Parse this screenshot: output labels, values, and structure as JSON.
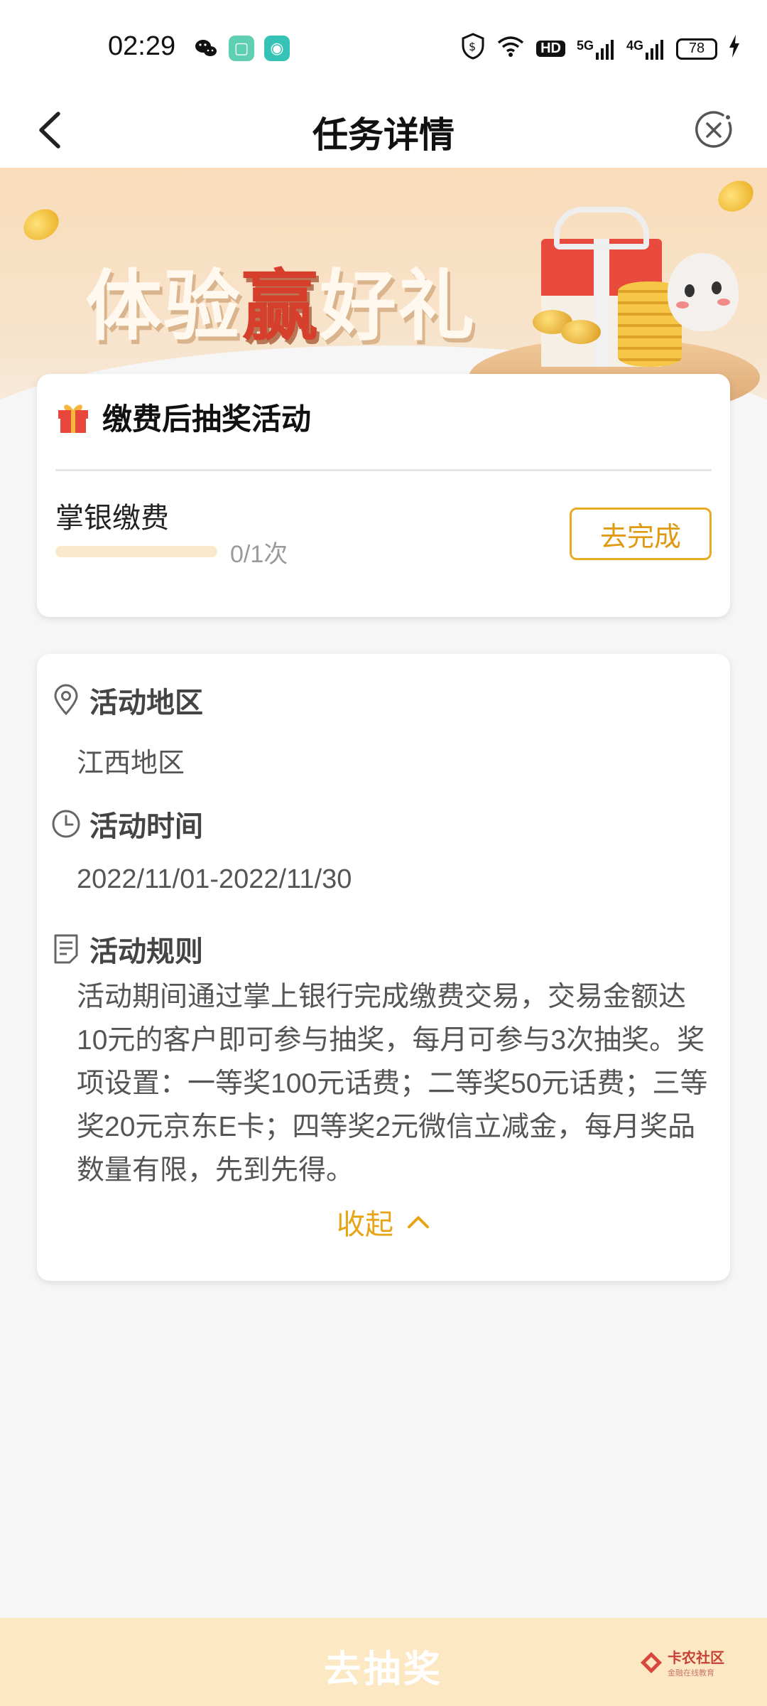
{
  "status_bar": {
    "time": "02:29",
    "hd_label": "HD",
    "net1": "5G",
    "net2": "4G",
    "battery": "78"
  },
  "nav": {
    "title": "任务详情"
  },
  "banner": {
    "title_part1": "体验",
    "title_highlight": "赢",
    "title_part2": "好礼"
  },
  "task_card": {
    "title": "缴费后抽奖活动",
    "task_name": "掌银缴费",
    "progress_text": "0/1次",
    "progress": 0,
    "button_label": "去完成"
  },
  "details": {
    "region_label": "活动地区",
    "region_value": "江西地区",
    "time_label": "活动时间",
    "time_value": "2022/11/01-2022/11/30",
    "rules_label": "活动规则",
    "rules_text": "活动期间通过掌上银行完成缴费交易，交易金额达10元的客户即可参与抽奖，每月可参与3次抽奖。奖项设置：一等奖100元话费；二等奖50元话费；三等奖20元京东E卡；四等奖2元微信立减金，每月奖品数量有限，先到先得。",
    "collapse_label": "收起"
  },
  "bottom": {
    "draw_button": "去抽奖"
  },
  "watermark": {
    "title": "卡农社区",
    "subtitle": "金融在线教育"
  },
  "colors": {
    "accent": "#e8a417",
    "highlight_red": "#d63f2c",
    "bottom_bar": "#fde8c4"
  }
}
